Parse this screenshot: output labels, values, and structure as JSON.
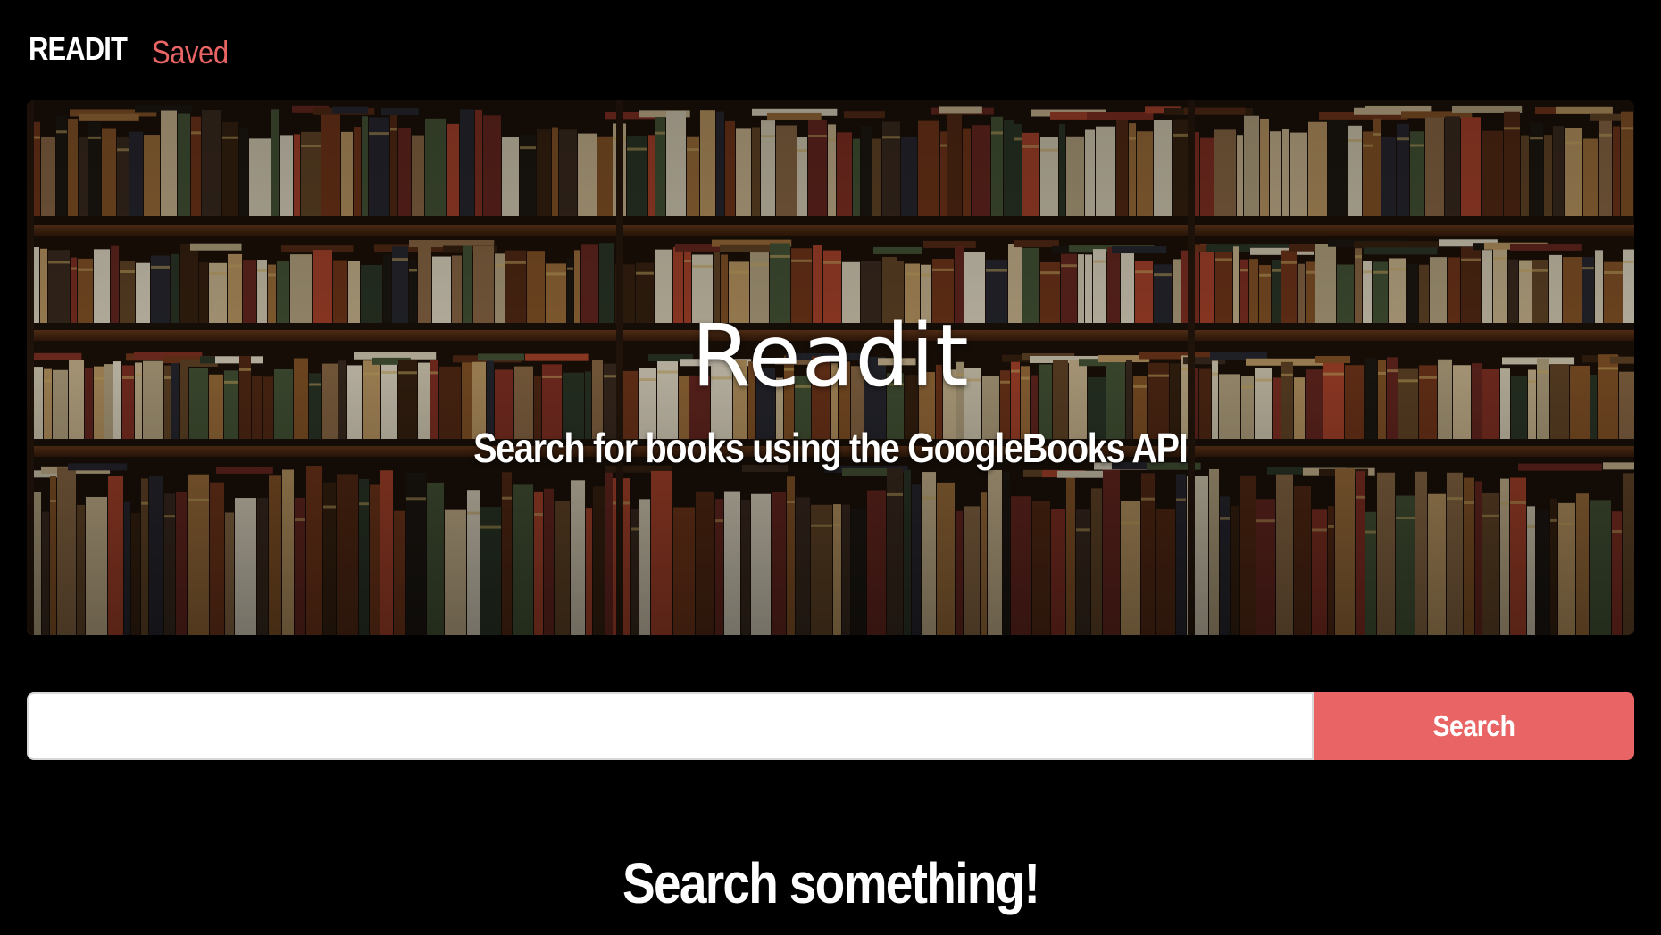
{
  "nav": {
    "brand": "READIT",
    "links": [
      {
        "label": "Saved"
      }
    ]
  },
  "hero": {
    "title": "Readit",
    "subtitle": "Search for books using the GoogleBooks API",
    "image": "bookshelf-photo"
  },
  "search": {
    "input_value": "",
    "placeholder": "",
    "button_label": "Search"
  },
  "results": {
    "empty_message": "Search something!"
  },
  "colors": {
    "background": "#000000",
    "accent": "#e96565",
    "text": "#ffffff"
  }
}
